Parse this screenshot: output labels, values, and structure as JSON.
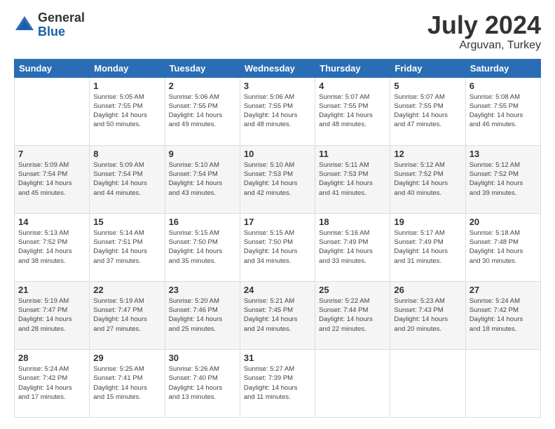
{
  "logo": {
    "general": "General",
    "blue": "Blue"
  },
  "title": "July 2024",
  "subtitle": "Arguvan, Turkey",
  "days_of_week": [
    "Sunday",
    "Monday",
    "Tuesday",
    "Wednesday",
    "Thursday",
    "Friday",
    "Saturday"
  ],
  "weeks": [
    [
      {
        "day": "",
        "info": ""
      },
      {
        "day": "1",
        "info": "Sunrise: 5:05 AM\nSunset: 7:55 PM\nDaylight: 14 hours\nand 50 minutes."
      },
      {
        "day": "2",
        "info": "Sunrise: 5:06 AM\nSunset: 7:55 PM\nDaylight: 14 hours\nand 49 minutes."
      },
      {
        "day": "3",
        "info": "Sunrise: 5:06 AM\nSunset: 7:55 PM\nDaylight: 14 hours\nand 48 minutes."
      },
      {
        "day": "4",
        "info": "Sunrise: 5:07 AM\nSunset: 7:55 PM\nDaylight: 14 hours\nand 48 minutes."
      },
      {
        "day": "5",
        "info": "Sunrise: 5:07 AM\nSunset: 7:55 PM\nDaylight: 14 hours\nand 47 minutes."
      },
      {
        "day": "6",
        "info": "Sunrise: 5:08 AM\nSunset: 7:55 PM\nDaylight: 14 hours\nand 46 minutes."
      }
    ],
    [
      {
        "day": "7",
        "info": "Sunrise: 5:09 AM\nSunset: 7:54 PM\nDaylight: 14 hours\nand 45 minutes."
      },
      {
        "day": "8",
        "info": "Sunrise: 5:09 AM\nSunset: 7:54 PM\nDaylight: 14 hours\nand 44 minutes."
      },
      {
        "day": "9",
        "info": "Sunrise: 5:10 AM\nSunset: 7:54 PM\nDaylight: 14 hours\nand 43 minutes."
      },
      {
        "day": "10",
        "info": "Sunrise: 5:10 AM\nSunset: 7:53 PM\nDaylight: 14 hours\nand 42 minutes."
      },
      {
        "day": "11",
        "info": "Sunrise: 5:11 AM\nSunset: 7:53 PM\nDaylight: 14 hours\nand 41 minutes."
      },
      {
        "day": "12",
        "info": "Sunrise: 5:12 AM\nSunset: 7:52 PM\nDaylight: 14 hours\nand 40 minutes."
      },
      {
        "day": "13",
        "info": "Sunrise: 5:12 AM\nSunset: 7:52 PM\nDaylight: 14 hours\nand 39 minutes."
      }
    ],
    [
      {
        "day": "14",
        "info": "Sunrise: 5:13 AM\nSunset: 7:52 PM\nDaylight: 14 hours\nand 38 minutes."
      },
      {
        "day": "15",
        "info": "Sunrise: 5:14 AM\nSunset: 7:51 PM\nDaylight: 14 hours\nand 37 minutes."
      },
      {
        "day": "16",
        "info": "Sunrise: 5:15 AM\nSunset: 7:50 PM\nDaylight: 14 hours\nand 35 minutes."
      },
      {
        "day": "17",
        "info": "Sunrise: 5:15 AM\nSunset: 7:50 PM\nDaylight: 14 hours\nand 34 minutes."
      },
      {
        "day": "18",
        "info": "Sunrise: 5:16 AM\nSunset: 7:49 PM\nDaylight: 14 hours\nand 33 minutes."
      },
      {
        "day": "19",
        "info": "Sunrise: 5:17 AM\nSunset: 7:49 PM\nDaylight: 14 hours\nand 31 minutes."
      },
      {
        "day": "20",
        "info": "Sunrise: 5:18 AM\nSunset: 7:48 PM\nDaylight: 14 hours\nand 30 minutes."
      }
    ],
    [
      {
        "day": "21",
        "info": "Sunrise: 5:19 AM\nSunset: 7:47 PM\nDaylight: 14 hours\nand 28 minutes."
      },
      {
        "day": "22",
        "info": "Sunrise: 5:19 AM\nSunset: 7:47 PM\nDaylight: 14 hours\nand 27 minutes."
      },
      {
        "day": "23",
        "info": "Sunrise: 5:20 AM\nSunset: 7:46 PM\nDaylight: 14 hours\nand 25 minutes."
      },
      {
        "day": "24",
        "info": "Sunrise: 5:21 AM\nSunset: 7:45 PM\nDaylight: 14 hours\nand 24 minutes."
      },
      {
        "day": "25",
        "info": "Sunrise: 5:22 AM\nSunset: 7:44 PM\nDaylight: 14 hours\nand 22 minutes."
      },
      {
        "day": "26",
        "info": "Sunrise: 5:23 AM\nSunset: 7:43 PM\nDaylight: 14 hours\nand 20 minutes."
      },
      {
        "day": "27",
        "info": "Sunrise: 5:24 AM\nSunset: 7:42 PM\nDaylight: 14 hours\nand 18 minutes."
      }
    ],
    [
      {
        "day": "28",
        "info": "Sunrise: 5:24 AM\nSunset: 7:42 PM\nDaylight: 14 hours\nand 17 minutes."
      },
      {
        "day": "29",
        "info": "Sunrise: 5:25 AM\nSunset: 7:41 PM\nDaylight: 14 hours\nand 15 minutes."
      },
      {
        "day": "30",
        "info": "Sunrise: 5:26 AM\nSunset: 7:40 PM\nDaylight: 14 hours\nand 13 minutes."
      },
      {
        "day": "31",
        "info": "Sunrise: 5:27 AM\nSunset: 7:39 PM\nDaylight: 14 hours\nand 11 minutes."
      },
      {
        "day": "",
        "info": ""
      },
      {
        "day": "",
        "info": ""
      },
      {
        "day": "",
        "info": ""
      }
    ]
  ]
}
